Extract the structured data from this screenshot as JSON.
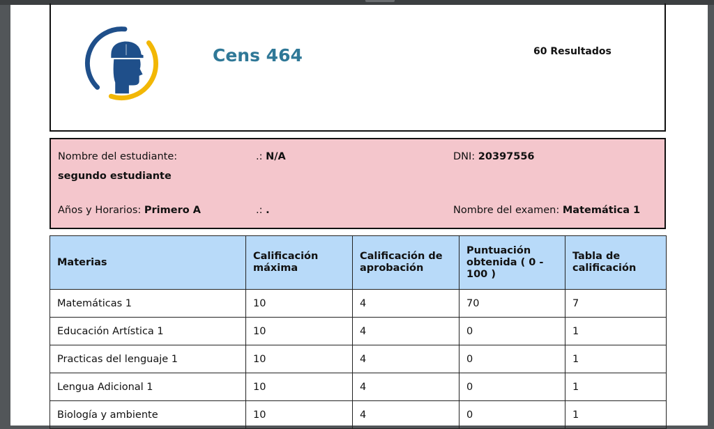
{
  "header": {
    "school_name": "Cens 464",
    "results_label": "60 Resultados"
  },
  "student_info": {
    "name_label": "Nombre del estudiante:",
    "name_value": "segundo estudiante",
    "na_prefix": ".:",
    "na_value": "N/A",
    "dni_label": "DNI:",
    "dni_value": "20397556",
    "year_label": "Años y Horarios:",
    "year_value": "Primero A",
    "dot_prefix": ".:",
    "dot_value": ".",
    "exam_label": "Nombre del examen:",
    "exam_value": "Matemática 1"
  },
  "table": {
    "headers": [
      "Materias",
      "Calificación máxima",
      "Calificación de aprobación",
      "Puntuación obtenida ( 0 - 100 )",
      "Tabla de calificación"
    ],
    "rows": [
      [
        "Matemáticas 1",
        "10",
        "4",
        "70",
        "7"
      ],
      [
        "Educación Artística 1",
        "10",
        "4",
        "0",
        "1"
      ],
      [
        "Practicas del lenguaje 1",
        "10",
        "4",
        "0",
        "1"
      ],
      [
        "Lengua Adicional 1",
        "10",
        "4",
        "0",
        "1"
      ],
      [
        "Biología y ambiente",
        "10",
        "4",
        "0",
        "1"
      ]
    ]
  },
  "colors": {
    "brand": "#2f7897",
    "info_background": "#f4c6cc",
    "table_header": "#b8daf9",
    "logo_blue": "#1f4f8a",
    "logo_yellow": "#f2b705"
  },
  "icons": [
    "school-logo-icon"
  ]
}
